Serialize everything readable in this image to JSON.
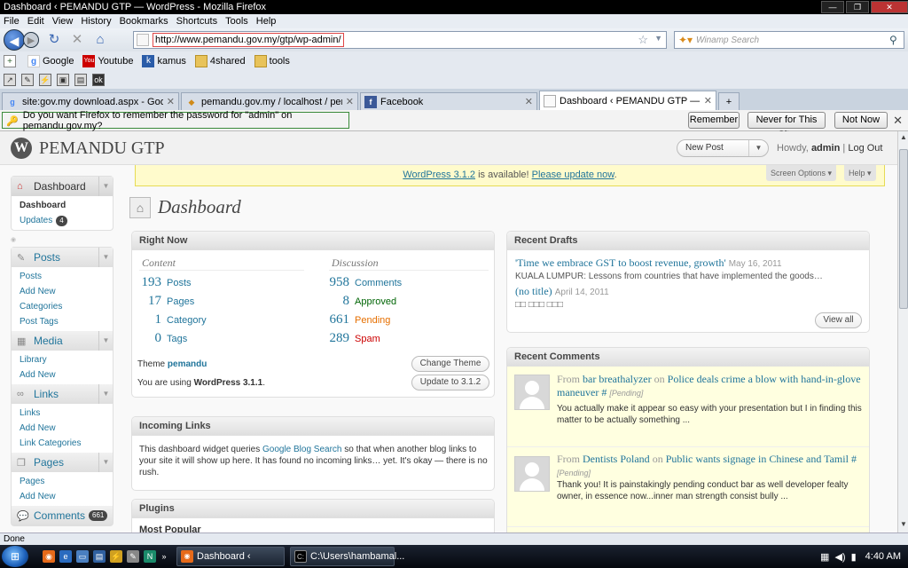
{
  "window": {
    "title": "Dashboard ‹ PEMANDU GTP — WordPress - Mozilla Firefox"
  },
  "menu": [
    "File",
    "Edit",
    "View",
    "History",
    "Bookmarks",
    "Shortcuts",
    "Tools",
    "Help"
  ],
  "nav": {
    "url": "http://www.pemandu.gov.my/gtp/wp-admin/",
    "search_placeholder": "Winamp Search"
  },
  "bookmarks": [
    {
      "label": "Google",
      "icon": "google-icon"
    },
    {
      "label": "Youtube",
      "icon": "youtube-icon"
    },
    {
      "label": "kamus",
      "icon": "kamus-icon"
    },
    {
      "label": "4shared",
      "icon": "folder-icon"
    },
    {
      "label": "tools",
      "icon": "folder-icon"
    }
  ],
  "tabs": [
    {
      "label": "site:gov.my download.aspx - Googl...",
      "icon": "google-icon",
      "active": false
    },
    {
      "label": "pemandu.gov.my / localhost / pem...",
      "icon": "pma-icon",
      "active": false
    },
    {
      "label": "Facebook",
      "icon": "facebook-icon",
      "active": false
    },
    {
      "label": "Dashboard ‹ PEMANDU GTP — W...",
      "icon": "page-icon",
      "active": true
    }
  ],
  "notification": {
    "message": "Do you want Firefox to remember the password for \"admin\" on pemandu.gov.my?",
    "remember": "Remember",
    "never": "Never for This Site",
    "not_now": "Not Now"
  },
  "wp_header": {
    "site_name": "PEMANDU GTP",
    "new_post": "New Post",
    "howdy": "Howdy,",
    "user": "admin",
    "sep": "|",
    "logout": "Log Out"
  },
  "update_nag": {
    "version_link": "WordPress 3.1.2",
    "middle": " is available! ",
    "update_link": "Please update now",
    "end": "."
  },
  "screen_options": "Screen Options",
  "help": "Help",
  "sidebar": {
    "dashboard": {
      "label": "Dashboard",
      "items": [
        {
          "label": "Dashboard"
        },
        {
          "label": "Updates",
          "badge": "4"
        }
      ]
    },
    "posts": {
      "label": "Posts",
      "items": [
        "Posts",
        "Add New",
        "Categories",
        "Post Tags"
      ]
    },
    "media": {
      "label": "Media",
      "items": [
        "Library",
        "Add New"
      ]
    },
    "links": {
      "label": "Links",
      "items": [
        "Links",
        "Add New",
        "Link Categories"
      ]
    },
    "pages": {
      "label": "Pages",
      "items": [
        "Pages",
        "Add New"
      ]
    },
    "comments": {
      "label": "Comments",
      "badge": "661"
    }
  },
  "page_title": "Dashboard",
  "right_now": {
    "title": "Right Now",
    "content_label": "Content",
    "discussion_label": "Discussion",
    "content": [
      {
        "num": "193",
        "label": "Posts"
      },
      {
        "num": "17",
        "label": "Pages"
      },
      {
        "num": "1",
        "label": "Category"
      },
      {
        "num": "0",
        "label": "Tags"
      }
    ],
    "discussion": [
      {
        "num": "958",
        "label": "Comments",
        "color": "#21759b"
      },
      {
        "num": "8",
        "label": "Approved",
        "color": "#006505"
      },
      {
        "num": "661",
        "label": "Pending",
        "color": "#e66f00"
      },
      {
        "num": "289",
        "label": "Spam",
        "color": "#cc0000"
      }
    ],
    "theme_prefix": "Theme ",
    "theme_name": "pemandu",
    "change_theme": "Change Theme",
    "using_prefix": "You are using ",
    "using_version": "WordPress 3.1.1",
    "using_suffix": ".",
    "update_btn": "Update to 3.1.2"
  },
  "incoming_links": {
    "title": "Incoming Links",
    "text_before": "This dashboard widget queries ",
    "link": "Google Blog Search",
    "text_after": " so that when another blog links to your site it will show up here. It has found no incoming links… yet. It's okay — there is no rush."
  },
  "plugins": {
    "title": "Plugins",
    "sub": "Most Popular"
  },
  "recent_drafts": {
    "title": "Recent Drafts",
    "items": [
      {
        "title": "'Time we embrace GST to boost revenue, growth'",
        "date": "May 16, 2011",
        "excerpt": "KUALA LUMPUR: Lessons from countries that have implemented the goods…"
      },
      {
        "title": "(no title)",
        "date": "April 14, 2011",
        "excerpt": "□□ □□□ □□□"
      }
    ],
    "view_all": "View all"
  },
  "recent_comments": {
    "title": "Recent Comments",
    "items": [
      {
        "from": "From",
        "author": "bar breathalyzer",
        "on": "on",
        "post": "Police deals crime a blow with hand-in-glove maneuver",
        "hash": "#",
        "status": "[Pending]",
        "body": "You actually make it appear so easy with your presentation but I in finding this matter to be actually something ..."
      },
      {
        "from": "From",
        "author": "Dentists Poland",
        "on": "on",
        "post": "Public wants signage in Chinese and Tamil",
        "hash": "#",
        "status": "[Pending]",
        "body": "Thank you! It is painstakingly pending conduct bar as well developer fealty owner, in essence now...inner man strength consist bully ..."
      }
    ]
  },
  "status_bar": "Done",
  "taskbar": {
    "tasks": [
      {
        "label": "Dashboard ‹ PEMA..."
      },
      {
        "label": "C:\\Users\\hambamal..."
      }
    ],
    "clock": "4:40 AM"
  }
}
